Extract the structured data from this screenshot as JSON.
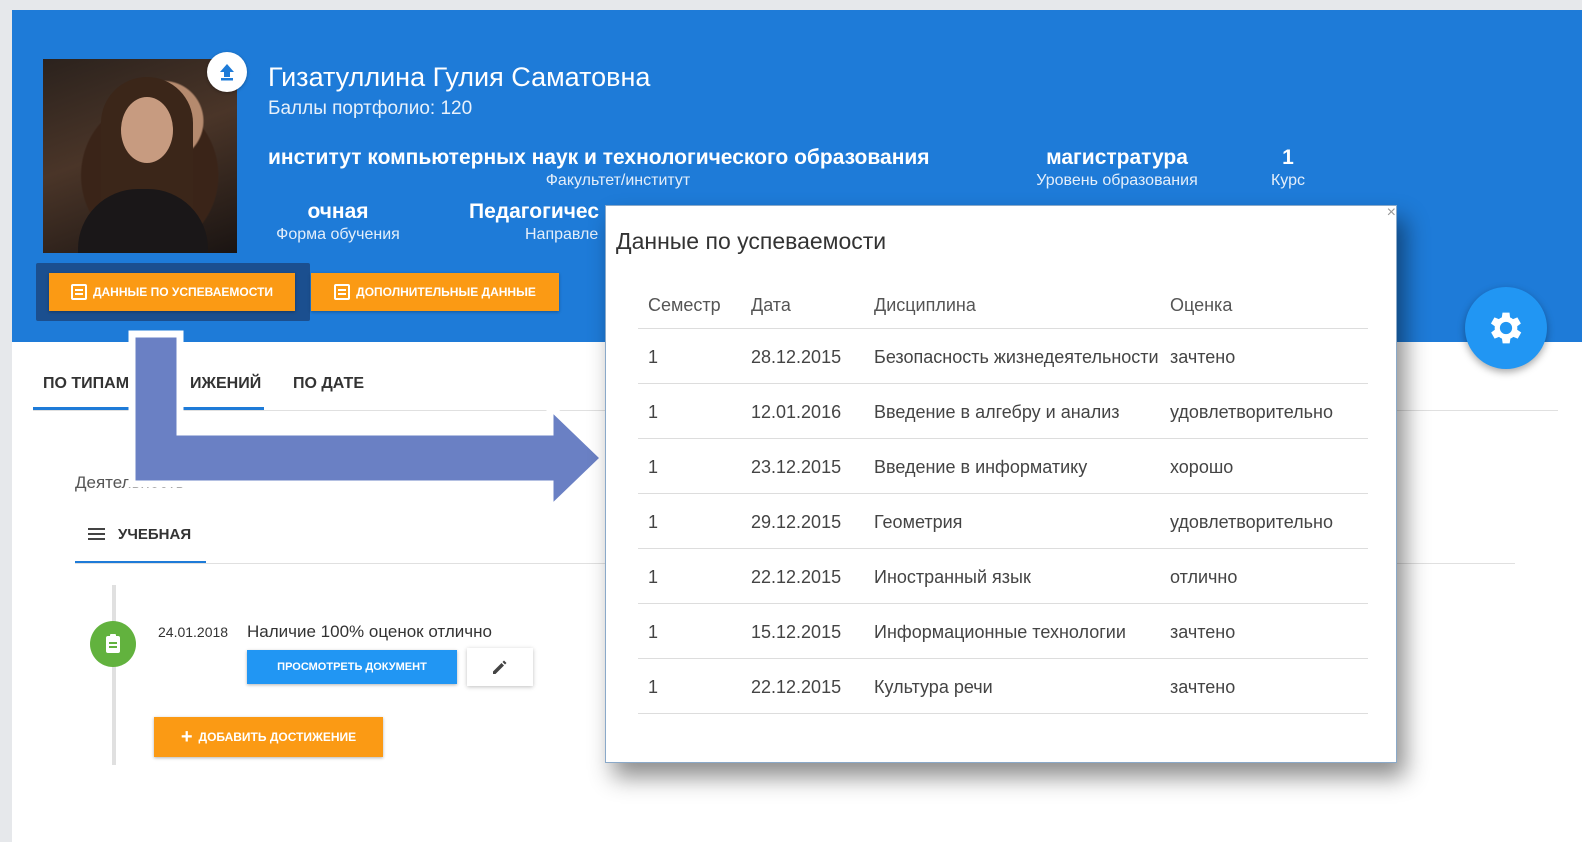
{
  "profile": {
    "name": "Гизатуллина Гулия Саматовна",
    "points": "Баллы портфолио: 120",
    "institute": {
      "value": "институт компьютерных наук и технологического образования",
      "label": "Факультет/институт"
    },
    "level": {
      "value": "магистратура",
      "label": "Уровень образования"
    },
    "course": {
      "value": "1",
      "label": "Курс"
    },
    "form": {
      "value": "очная",
      "label": "Форма обучения"
    },
    "direction": {
      "value": "Педагогичес",
      "label": "Направле"
    }
  },
  "actions": {
    "grades_button": "данные по успеваемости",
    "extra_button": "дополнительные данные"
  },
  "tabs": {
    "by_type": "по типам",
    "by_type_tail": "ижений",
    "by_date": "по дате"
  },
  "activity": {
    "label": "Деятельность",
    "subtab": "УЧЕБНАЯ"
  },
  "achievement": {
    "date": "24.01.2018",
    "text": "Наличие 100% оценок отлично",
    "view_button": "просмотреть документ",
    "add_button": "добавить достижение"
  },
  "modal": {
    "title": "Данные по успеваемости",
    "close": "×",
    "columns": [
      "Семестр",
      "Дата",
      "Дисциплина",
      "Оценка"
    ],
    "rows": [
      [
        "1",
        "28.12.2015",
        "Безопасность жизнедеятельности",
        "зачтено"
      ],
      [
        "1",
        "12.01.2016",
        "Введение в алгебру и анализ",
        "удовлетворительно"
      ],
      [
        "1",
        "23.12.2015",
        "Введение в информатику",
        "хорошо"
      ],
      [
        "1",
        "29.12.2015",
        "Геометрия",
        "удовлетворительно"
      ],
      [
        "1",
        "22.12.2015",
        "Иностранный язык",
        "отлично"
      ],
      [
        "1",
        "15.12.2015",
        "Информационные технологии",
        "зачтено"
      ],
      [
        "1",
        "22.12.2015",
        "Культура речи",
        "зачтено"
      ]
    ]
  },
  "colors": {
    "banner": "#1e7bd8",
    "accent_orange": "#fb9a14",
    "accent_blue": "#2196f3",
    "timeline_green": "#62b23e"
  },
  "icons": {
    "upload": "upload-icon",
    "gear": "gear-icon",
    "edit": "pencil-icon",
    "menu": "menu-icon",
    "document": "document-icon"
  }
}
